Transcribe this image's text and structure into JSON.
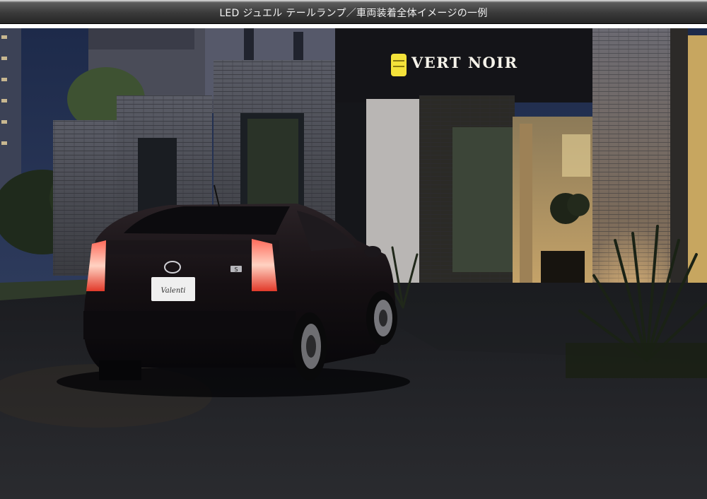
{
  "header": {
    "title": "LED ジュエル テールランプ／車両装着全体イメージの一例"
  },
  "photo": {
    "sign_text": "VERT NOIR",
    "plate_text": "Valenti",
    "badge_text": "S"
  }
}
